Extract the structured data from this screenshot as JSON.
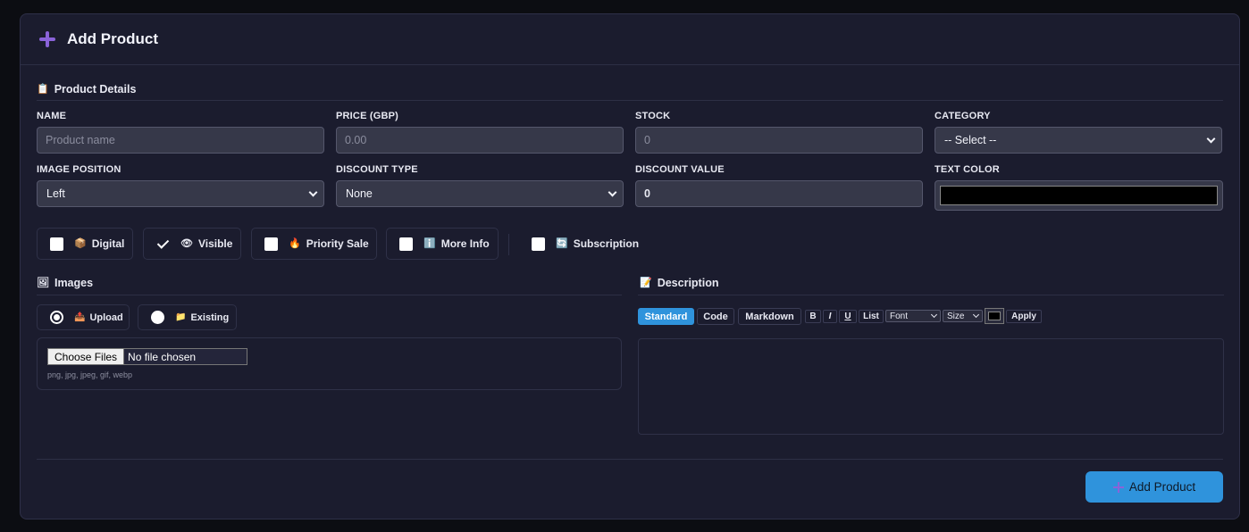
{
  "header": {
    "title": "Add Product",
    "icon": "plus-icon"
  },
  "details": {
    "title": "Product Details",
    "fields": {
      "name": {
        "label": "NAME",
        "placeholder": "Product name",
        "value": ""
      },
      "price": {
        "label": "PRICE (GBP)",
        "placeholder": "0.00",
        "value": ""
      },
      "stock": {
        "label": "STOCK",
        "placeholder": "0",
        "value": ""
      },
      "category": {
        "label": "CATEGORY",
        "value": "-- Select --"
      },
      "image_position": {
        "label": "IMAGE POSITION",
        "value": "Left"
      },
      "discount_type": {
        "label": "DISCOUNT TYPE",
        "value": "None"
      },
      "discount_value": {
        "label": "DISCOUNT VALUE",
        "value": "0"
      },
      "text_color": {
        "label": "TEXT COLOR",
        "value": "#000000"
      }
    }
  },
  "toggles": [
    {
      "label": "Digital",
      "emoji": "📦",
      "checked": false
    },
    {
      "label": "Visible",
      "emoji": "👁",
      "checked": true
    },
    {
      "label": "Priority Sale",
      "emoji": "🔥",
      "checked": false
    },
    {
      "label": "More Info",
      "emoji": "ℹ️",
      "checked": false
    },
    {
      "label": "Subscription",
      "emoji": "🔄",
      "checked": false
    }
  ],
  "images": {
    "title": "Images",
    "emoji": "🖼",
    "source_options": [
      {
        "label": "Upload",
        "emoji": "📤",
        "selected": true
      },
      {
        "label": "Existing",
        "emoji": "📁",
        "selected": false
      }
    ],
    "choose_files_label": "Choose Files",
    "file_status": "No file chosen",
    "hint": "png, jpg, jpeg, gif, webp"
  },
  "description": {
    "title": "Description",
    "emoji": "📝",
    "modes": [
      "Standard",
      "Code",
      "Markdown"
    ],
    "active_mode": "Standard",
    "format_buttons": [
      "B",
      "I",
      "U",
      "List"
    ],
    "font_select": "Font",
    "size_select": "Size",
    "apply_label": "Apply",
    "color": "#000000"
  },
  "submit": {
    "label": "Add Product"
  },
  "colors": {
    "accent": "#2f93dc",
    "icon_purple": "#8a63d9",
    "panel": "#1b1c2e"
  }
}
